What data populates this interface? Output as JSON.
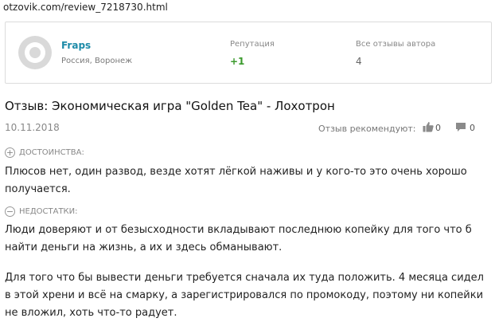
{
  "url": "otzovik.com/review_7218730.html",
  "author": {
    "name": "Fraps",
    "location": "Россия, Воронеж",
    "reputation_label": "Репутация",
    "reputation_value": "+1",
    "reviews_label": "Все отзывы автора",
    "reviews_value": "4"
  },
  "review": {
    "title": "Отзыв: Экономическая игра \"Golden Tea\" - Лохотрон",
    "date": "10.11.2018",
    "recommend_label": "Отзыв рекомендуют:",
    "likes": "0",
    "comments": "0",
    "pros_label": "ДОСТОИНСТВА:",
    "pros_icon": "+",
    "pros_text": "Плюсов нет, один развод, везде хотят лёгкой наживы и у кого-то это очень хорошо получается.",
    "cons_label": "НЕДОСТАТКИ:",
    "cons_icon": "−",
    "cons_text": "Люди доверяют и от безысходности вкладывают последнюю копейку для того что б найти деньги на жизнь, а их и здесь обманывают.",
    "body": "Для того что бы вывести деньги требуется сначала их туда положить. 4 месяца сидел в этой хрени и всё на смарку, а зарегистрировался по промокоду, поэтому ни копейки не вложил, хоть что-то радует."
  },
  "icons": {
    "avatar": "default-avatar-icon",
    "like": "thumbs-up-icon",
    "comment": "comment-icon"
  },
  "colors": {
    "author_link": "#1d8ba8",
    "reputation_positive": "#3a9a2c"
  }
}
